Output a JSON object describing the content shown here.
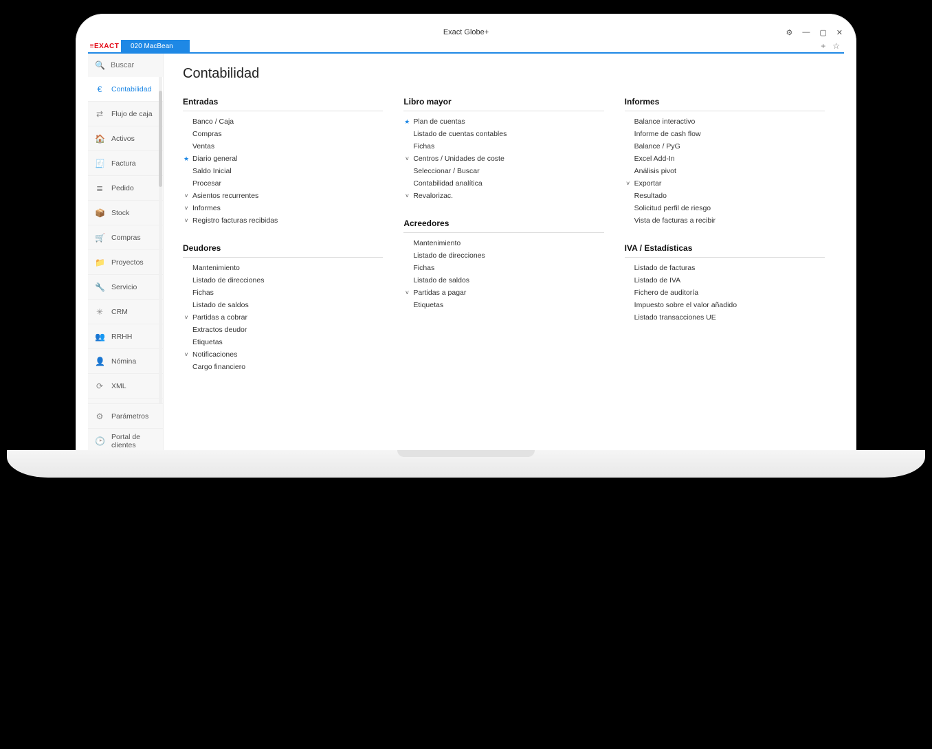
{
  "window": {
    "title": "Exact Globe+"
  },
  "brand": "≡EXACT",
  "tab": {
    "label": "020   MacBean"
  },
  "search": {
    "placeholder": "Buscar"
  },
  "sidebar": {
    "items": [
      {
        "icon": "€",
        "label": "Contabilidad",
        "active": true
      },
      {
        "icon": "⇄",
        "label": "Flujo de caja"
      },
      {
        "icon": "🏠",
        "label": "Activos"
      },
      {
        "icon": "🧾",
        "label": "Factura"
      },
      {
        "icon": "≣",
        "label": "Pedido"
      },
      {
        "icon": "📦",
        "label": "Stock"
      },
      {
        "icon": "🛒",
        "label": "Compras"
      },
      {
        "icon": "📁",
        "label": "Proyectos"
      },
      {
        "icon": "🔧",
        "label": "Servicio"
      },
      {
        "icon": "✳",
        "label": "CRM"
      },
      {
        "icon": "👥",
        "label": "RRHH"
      },
      {
        "icon": "👤",
        "label": "Nómina"
      },
      {
        "icon": "⟳",
        "label": "XML"
      }
    ],
    "bottom": [
      {
        "icon": "⚙",
        "label": "Parámetros"
      },
      {
        "icon": "🕑",
        "label": "Portal de clientes"
      }
    ]
  },
  "page": {
    "title": "Contabilidad",
    "columns": [
      [
        {
          "heading": "Entradas",
          "links": [
            {
              "label": "Banco / Caja"
            },
            {
              "label": "Compras"
            },
            {
              "label": "Ventas"
            },
            {
              "label": "Diario general",
              "star": true
            },
            {
              "label": "Saldo Inicial"
            },
            {
              "label": "Procesar"
            },
            {
              "label": "Asientos recurrentes",
              "chev": true
            },
            {
              "label": "Informes",
              "chev": true
            },
            {
              "label": "Registro facturas recibidas",
              "chev": true
            }
          ]
        },
        {
          "heading": "Deudores",
          "links": [
            {
              "label": "Mantenimiento"
            },
            {
              "label": "Listado de direcciones"
            },
            {
              "label": "Fichas"
            },
            {
              "label": "Listado de saldos"
            },
            {
              "label": "Partidas a cobrar",
              "chev": true
            },
            {
              "label": "Extractos deudor"
            },
            {
              "label": "Etiquetas"
            },
            {
              "label": "Notificaciones",
              "chev": true
            },
            {
              "label": "Cargo financiero"
            }
          ]
        }
      ],
      [
        {
          "heading": "Libro mayor",
          "links": [
            {
              "label": "Plan de cuentas",
              "star": true
            },
            {
              "label": "Listado de cuentas contables"
            },
            {
              "label": "Fichas"
            },
            {
              "label": "Centros / Unidades de coste",
              "chev": true
            },
            {
              "label": "Seleccionar  / Buscar"
            },
            {
              "label": "Contabilidad analítica"
            },
            {
              "label": "Revalorizac.",
              "chev": true
            }
          ]
        },
        {
          "heading": "Acreedores",
          "links": [
            {
              "label": "Mantenimiento"
            },
            {
              "label": "Listado de direcciones"
            },
            {
              "label": "Fichas"
            },
            {
              "label": "Listado de saldos"
            },
            {
              "label": "Partidas a pagar",
              "chev": true
            },
            {
              "label": "Etiquetas"
            }
          ]
        }
      ],
      [
        {
          "heading": "Informes",
          "links": [
            {
              "label": "Balance interactivo"
            },
            {
              "label": "Informe de cash flow"
            },
            {
              "label": "Balance / PyG"
            },
            {
              "label": "Excel Add-In"
            },
            {
              "label": "Análisis pivot"
            },
            {
              "label": "Exportar",
              "chev": true
            },
            {
              "label": "Resultado"
            },
            {
              "label": "Solicitud perfil de riesgo"
            },
            {
              "label": "Vista de facturas a recibir"
            }
          ]
        },
        {
          "heading": "IVA / Estadísticas",
          "links": [
            {
              "label": "Listado de facturas"
            },
            {
              "label": "Listado de IVA"
            },
            {
              "label": "Fichero de auditoría"
            },
            {
              "label": "Impuesto sobre el valor añadido"
            },
            {
              "label": "Listado transacciones UE"
            }
          ]
        }
      ]
    ]
  }
}
